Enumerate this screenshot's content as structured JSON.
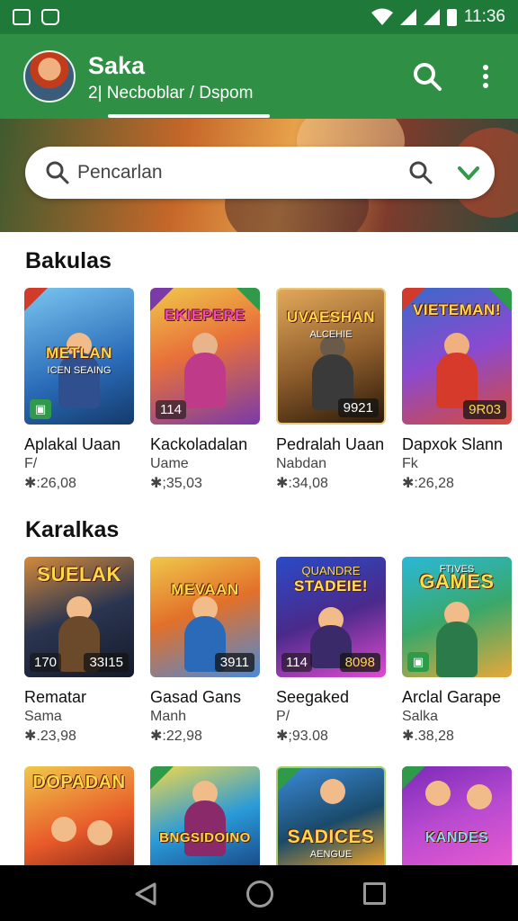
{
  "status_bar": {
    "time": "11:36"
  },
  "header": {
    "title": "Saka",
    "subtitle": "2| Necboblar / Dspom"
  },
  "search": {
    "placeholder": "Pencarlan"
  },
  "sections": [
    {
      "title": "Bakulas",
      "cards": [
        {
          "thumb_title": "METLAN",
          "thumb_sub": "ICEN SEAING",
          "left_label": "",
          "score": "",
          "name": "Aplakal Uaan",
          "developer": "F/",
          "rating": "✱:26,08",
          "art": [
            "#2a6bb8",
            "#79c5f0"
          ]
        },
        {
          "thumb_title": "EKIEPERE",
          "thumb_sub": "",
          "left_label": "114",
          "score": "",
          "name": "Kackoladalan",
          "developer": "Uame",
          "rating": "✱;35,03",
          "art": [
            "#e8b33a",
            "#7a3aa8"
          ]
        },
        {
          "thumb_title": "UVAESHAN",
          "thumb_sub": "ALCEHIE",
          "left_label": "",
          "score": "9921",
          "name": "Pedralah Uaan",
          "developer": "Nabdan",
          "rating": "✱:34,08",
          "art": [
            "#8a5a2a",
            "#e2a85a"
          ]
        },
        {
          "thumb_title": "VIETEMAN!",
          "thumb_sub": "",
          "left_label": "",
          "score": "9R03",
          "name": "Dapxok Slann",
          "developer": "Fk",
          "rating": "✱:26,28",
          "art": [
            "#3a6ac8",
            "#d64a3a"
          ]
        }
      ]
    },
    {
      "title": "Karalkas",
      "cards": [
        {
          "thumb_title": "SUELAK",
          "thumb_sub": "",
          "left_label": "170",
          "score": "33I15",
          "name": "Rematar",
          "developer": "Sama",
          "rating": "✱.23,98",
          "art": [
            "#2b3550",
            "#d48a3a"
          ]
        },
        {
          "thumb_title": "MEVAAN",
          "thumb_sub": "",
          "left_label": "",
          "score": "3911",
          "name": "Gasad Gans",
          "developer": "Manh",
          "rating": "✱:22,98",
          "art": [
            "#e2702a",
            "#4a8ad8"
          ]
        },
        {
          "thumb_title": "STADEIE!",
          "thumb_sub": "QUANDRE",
          "left_label": "114",
          "score": "8098",
          "name": "Seegaked",
          "developer": "P/",
          "rating": "✱;93.08",
          "art": [
            "#4a2a8a",
            "#e24ad0"
          ]
        },
        {
          "thumb_title": "GAMES",
          "thumb_sub": "FTIVES",
          "left_label": "",
          "score": "",
          "name": "Arclal Garape",
          "developer": "Salka",
          "rating": "✱.38,28",
          "art": [
            "#2ab8d8",
            "#e8a83a"
          ]
        }
      ]
    },
    {
      "title": "",
      "cards": [
        {
          "thumb_title": "DOPADAN",
          "thumb_sub": "",
          "art": [
            "#e85a2a",
            "#f0c84a"
          ]
        },
        {
          "thumb_title": "BNGSIDOINO",
          "thumb_sub": "",
          "art": [
            "#2a9ad8",
            "#f0d84a"
          ]
        },
        {
          "thumb_title": "SADICES",
          "thumb_sub": "AENGUE",
          "art": [
            "#1a4a6a",
            "#e8a02a"
          ]
        },
        {
          "thumb_title": "KANDES",
          "thumb_sub": "",
          "art": [
            "#7a2ab8",
            "#e85ad0"
          ]
        }
      ]
    }
  ]
}
